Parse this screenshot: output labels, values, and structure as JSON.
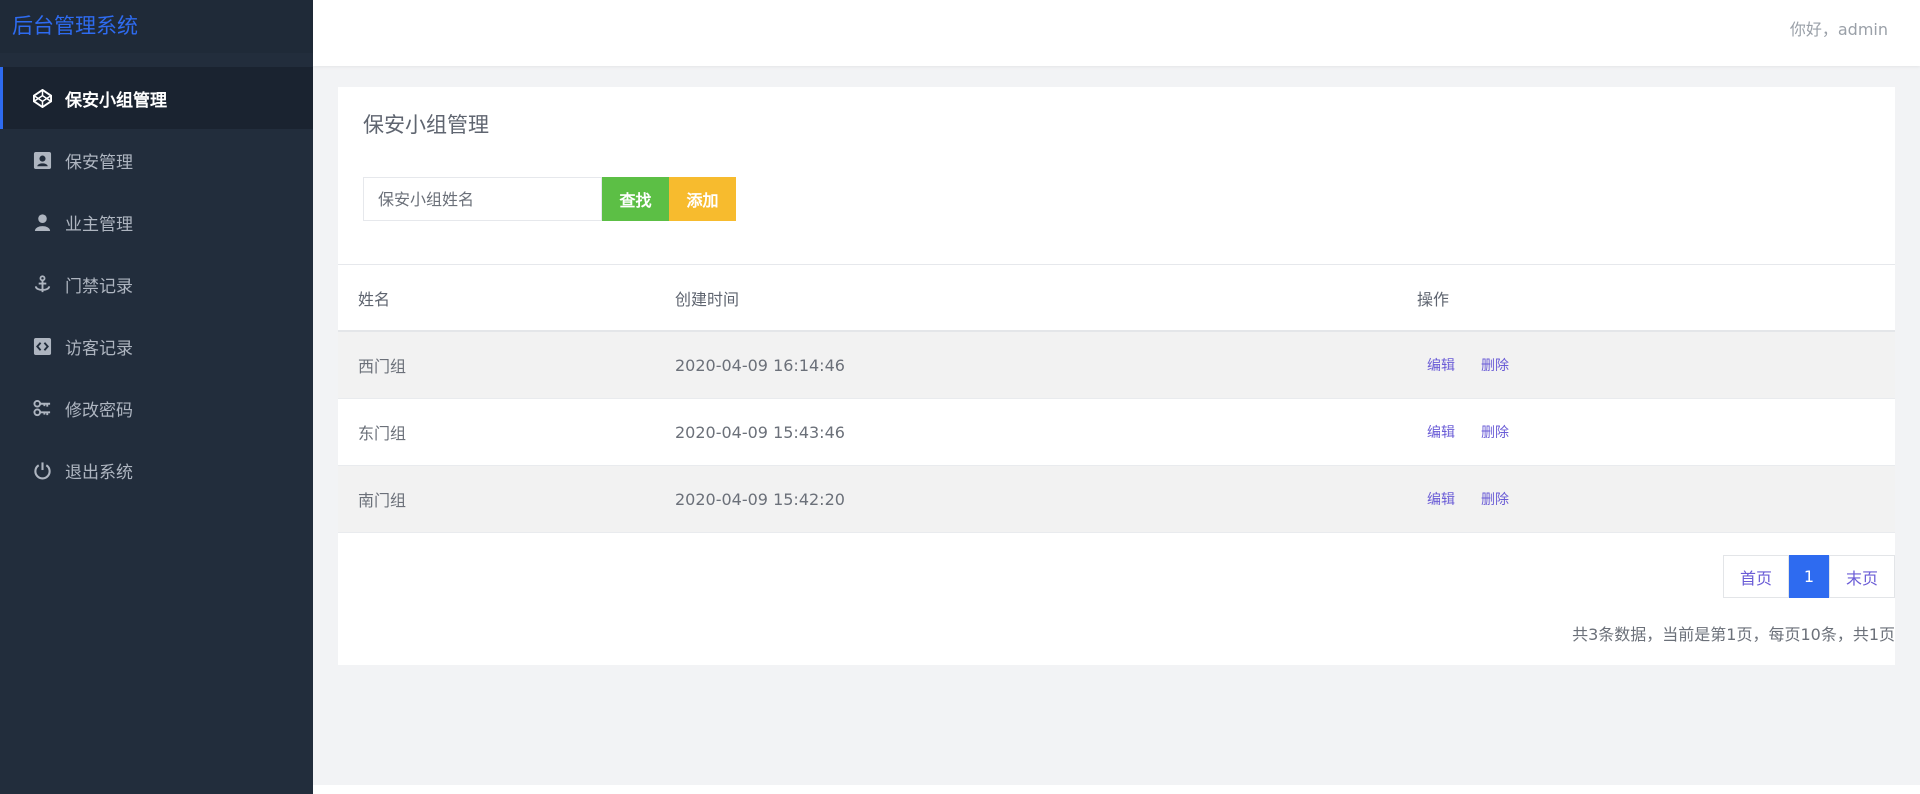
{
  "app": {
    "title": "后台管理系统"
  },
  "header": {
    "greeting": "你好，admin"
  },
  "sidebar": {
    "items": [
      {
        "label": "保安小组管理",
        "icon": "codepen-icon",
        "active": true
      },
      {
        "label": "保安管理",
        "icon": "id-card-icon",
        "active": false
      },
      {
        "label": "业主管理",
        "icon": "user-icon",
        "active": false
      },
      {
        "label": "门禁记录",
        "icon": "anchor-icon",
        "active": false
      },
      {
        "label": "访客记录",
        "icon": "code-square-icon",
        "active": false
      },
      {
        "label": "修改密码",
        "icon": "keys-icon",
        "active": false
      },
      {
        "label": "退出系统",
        "icon": "power-icon",
        "active": false
      }
    ]
  },
  "page": {
    "title": "保安小组管理",
    "search": {
      "placeholder": "保安小组姓名",
      "value": ""
    },
    "buttons": {
      "search": "查找",
      "add": "添加"
    }
  },
  "table": {
    "headers": {
      "name": "姓名",
      "created": "创建时间",
      "actions": "操作"
    },
    "rows": [
      {
        "name": "西门组",
        "created": "2020-04-09 16:14:46",
        "edit": "编辑",
        "delete": "删除"
      },
      {
        "name": "东门组",
        "created": "2020-04-09 15:43:46",
        "edit": "编辑",
        "delete": "删除"
      },
      {
        "name": "南门组",
        "created": "2020-04-09 15:42:20",
        "edit": "编辑",
        "delete": "删除"
      }
    ]
  },
  "pagination": {
    "first": "首页",
    "current": "1",
    "last": "末页",
    "summary": "共3条数据，当前是第1页，每页10条，共1页"
  },
  "colors": {
    "sidebar_bg": "#222d3c",
    "accent": "#2e6bf0",
    "search_button": "#5cbf45",
    "add_button": "#f7bb2e",
    "link": "#6a5cd6"
  }
}
